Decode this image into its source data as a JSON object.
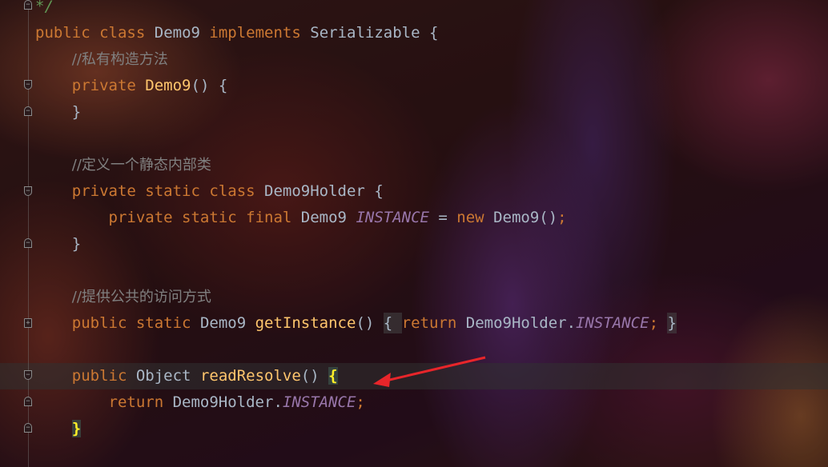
{
  "editor": {
    "lines": [
      {
        "segments": [
          {
            "t": "comment_end",
            "v": "*/"
          }
        ]
      },
      {
        "segments": [
          {
            "t": "kw",
            "v": "public"
          },
          {
            "t": "sp",
            "v": " "
          },
          {
            "t": "kw",
            "v": "class"
          },
          {
            "t": "sp",
            "v": " "
          },
          {
            "t": "cls",
            "v": "Demo9"
          },
          {
            "t": "sp",
            "v": " "
          },
          {
            "t": "kw",
            "v": "implements"
          },
          {
            "t": "sp",
            "v": " "
          },
          {
            "t": "cls",
            "v": "Serializable {"
          }
        ]
      },
      {
        "segments": [
          {
            "t": "sp",
            "v": "    "
          },
          {
            "t": "cm",
            "v": "//私有构造方法"
          }
        ]
      },
      {
        "segments": [
          {
            "t": "sp",
            "v": "    "
          },
          {
            "t": "kw",
            "v": "private"
          },
          {
            "t": "sp",
            "v": " "
          },
          {
            "t": "fn",
            "v": "Demo9"
          },
          {
            "t": "id",
            "v": "() {"
          }
        ]
      },
      {
        "segments": [
          {
            "t": "sp",
            "v": "    "
          },
          {
            "t": "id",
            "v": "}"
          }
        ]
      },
      {
        "segments": []
      },
      {
        "segments": [
          {
            "t": "sp",
            "v": "    "
          },
          {
            "t": "cm",
            "v": "//定义一个静态内部类"
          }
        ]
      },
      {
        "segments": [
          {
            "t": "sp",
            "v": "    "
          },
          {
            "t": "kw",
            "v": "private"
          },
          {
            "t": "sp",
            "v": " "
          },
          {
            "t": "kw",
            "v": "static"
          },
          {
            "t": "sp",
            "v": " "
          },
          {
            "t": "kw",
            "v": "class"
          },
          {
            "t": "sp",
            "v": " "
          },
          {
            "t": "cls",
            "v": "Demo9Holder {"
          }
        ]
      },
      {
        "segments": [
          {
            "t": "sp",
            "v": "        "
          },
          {
            "t": "kw",
            "v": "private"
          },
          {
            "t": "sp",
            "v": " "
          },
          {
            "t": "kw",
            "v": "static"
          },
          {
            "t": "sp",
            "v": " "
          },
          {
            "t": "kw",
            "v": "final"
          },
          {
            "t": "sp",
            "v": " "
          },
          {
            "t": "cls",
            "v": "Demo9"
          },
          {
            "t": "sp",
            "v": " "
          },
          {
            "t": "cons",
            "v": "INSTANCE"
          },
          {
            "t": "id",
            "v": " = "
          },
          {
            "t": "kw",
            "v": "new"
          },
          {
            "t": "sp",
            "v": " "
          },
          {
            "t": "id",
            "v": "Demo9()"
          },
          {
            "t": "semi",
            "v": ";"
          }
        ]
      },
      {
        "segments": [
          {
            "t": "sp",
            "v": "    "
          },
          {
            "t": "id",
            "v": "}"
          }
        ]
      },
      {
        "segments": []
      },
      {
        "segments": [
          {
            "t": "sp",
            "v": "    "
          },
          {
            "t": "cm",
            "v": "//提供公共的访问方式"
          }
        ]
      },
      {
        "segments": [
          {
            "t": "sp",
            "v": "    "
          },
          {
            "t": "kw",
            "v": "public"
          },
          {
            "t": "sp",
            "v": " "
          },
          {
            "t": "kw",
            "v": "static"
          },
          {
            "t": "sp",
            "v": " "
          },
          {
            "t": "cls",
            "v": "Demo9"
          },
          {
            "t": "sp",
            "v": " "
          },
          {
            "t": "fn",
            "v": "getInstance"
          },
          {
            "t": "id",
            "v": "() "
          },
          {
            "t": "hl",
            "v": "{ "
          },
          {
            "t": "kw",
            "v": "return"
          },
          {
            "t": "sp",
            "v": " "
          },
          {
            "t": "id",
            "v": "Demo9Holder."
          },
          {
            "t": "cons",
            "v": "INSTANCE"
          },
          {
            "t": "semi",
            "v": ";"
          },
          {
            "t": "sp",
            "v": " "
          },
          {
            "t": "hl",
            "v": "}"
          }
        ]
      },
      {
        "segments": []
      },
      {
        "segments": [
          {
            "t": "sp",
            "v": "    "
          },
          {
            "t": "kw",
            "v": "public"
          },
          {
            "t": "sp",
            "v": " "
          },
          {
            "t": "cls",
            "v": "Object"
          },
          {
            "t": "sp",
            "v": " "
          },
          {
            "t": "fn",
            "v": "readResolve"
          },
          {
            "t": "id",
            "v": "() "
          },
          {
            "t": "brace",
            "v": "{"
          }
        ]
      },
      {
        "segments": [
          {
            "t": "sp",
            "v": "        "
          },
          {
            "t": "kw",
            "v": "return"
          },
          {
            "t": "sp",
            "v": " "
          },
          {
            "t": "id",
            "v": "Demo9Holder."
          },
          {
            "t": "cons",
            "v": "INSTANCE"
          },
          {
            "t": "semi",
            "v": ";"
          }
        ]
      },
      {
        "segments": [
          {
            "t": "sp",
            "v": "    "
          },
          {
            "t": "brace",
            "v": "}"
          }
        ]
      }
    ]
  },
  "colors": {
    "keyword": "#cc7832",
    "identifier": "#a9b7c6",
    "comment": "#808080",
    "function": "#ffc66d",
    "constant": "#9876aa",
    "brace_match": "#ffef28",
    "annotation_arrow": "#e8252a"
  }
}
